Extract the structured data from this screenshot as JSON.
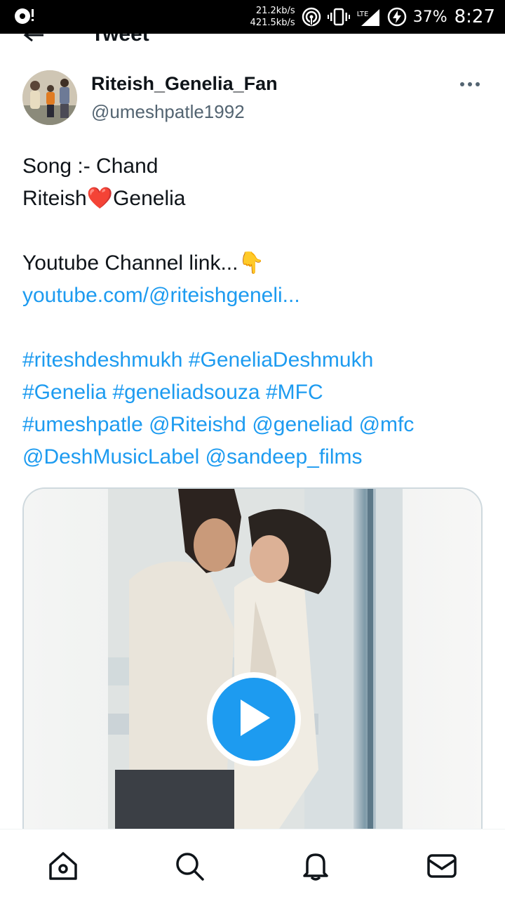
{
  "status_bar": {
    "net_up": "21.2kb/s",
    "net_down": "421.5kb/s",
    "network_type": "LTE",
    "battery_percent": "37%",
    "time": "8:27"
  },
  "header": {
    "title": "Tweet",
    "back_icon": "arrow-left-icon"
  },
  "author": {
    "display_name": "Riteish_Genelia_Fan",
    "handle": "@umeshpatle1992",
    "more_icon": "more-horizontal-icon"
  },
  "tweet": {
    "line1": "Song :- Chand",
    "line2_a": "Riteish",
    "line2_emoji": "❤️",
    "line2_b": "Genelia",
    "line3": "Youtube Channel link...",
    "line3_emoji": "👇",
    "link": "youtube.com/@riteishgeneli...",
    "hashtags": {
      "h1": "#riteshdeshmukh",
      "h2": "#GeneliaDeshmukh",
      "h3": "#Genelia",
      "h4": "#geneliadsouza",
      "h5": "#MFC",
      "h6": "#umeshpatle",
      "m1": "@Riteishd",
      "m2": "@geneliad",
      "m3": "@mfc",
      "m4": "@DeshMusicLabel",
      "m5": "@sandeep_films"
    }
  },
  "media": {
    "type": "video",
    "play_icon": "play-icon"
  },
  "bottom_nav": {
    "items": [
      {
        "icon": "home-icon"
      },
      {
        "icon": "search-icon"
      },
      {
        "icon": "notifications-icon"
      },
      {
        "icon": "messages-icon"
      }
    ]
  },
  "colors": {
    "accent": "#1d9bf0",
    "text": "#0f1419",
    "secondary_text": "#536471",
    "status_bar_bg": "#000000"
  }
}
